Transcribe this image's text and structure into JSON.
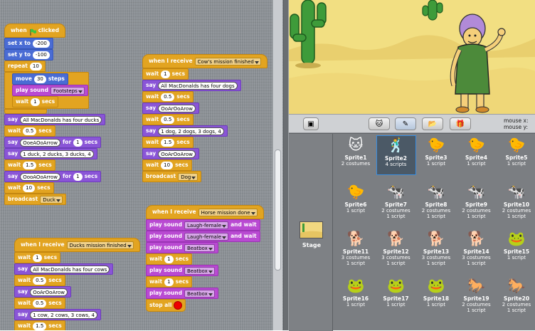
{
  "scripts": {
    "s1": {
      "hat_when": "when",
      "hat_clicked": "clicked",
      "set_x": "set x to",
      "set_x_val": "-200",
      "set_y": "set y to",
      "set_y_val": "-100",
      "repeat": "repeat",
      "repeat_val": "10",
      "move": "move",
      "move_val": "30",
      "move_steps": "steps",
      "play_sound": "play sound",
      "sound_val": "Footsteps",
      "wait1": "wait",
      "wait1_val": "1",
      "secs": "secs",
      "say1": "say",
      "say1_val": "All MacDonalds has four ducks",
      "wait2": "wait",
      "wait2_val": "0.5",
      "say2": "say",
      "say2_val": "OoeAOoArrow",
      "for": "for",
      "say2_secs": "1",
      "say3": "say",
      "say3_val": "1 duck, 2 ducks, 3 ducks, 4",
      "wait3": "wait",
      "wait3_val": "1.5",
      "say4": "say",
      "say4_val": "OooAOoArrow",
      "say4_secs": "1",
      "wait4": "wait",
      "wait4_val": "10",
      "broadcast": "broadcast",
      "broadcast_val": "Duck"
    },
    "s2": {
      "hat": "when I receive",
      "hat_val": "Cow's mission finished",
      "wait1_val": "1",
      "say1_val": "All MacDonalds has four dogs",
      "wait2_val": "0.5",
      "say2_val": "OoArOoArow",
      "wait3_val": "0.5",
      "say3_val": "1 dog, 2 dogs, 3 dogs, 4",
      "wait4_val": "1.5",
      "say4_val": "OoArOoArow",
      "wait5_val": "10",
      "broadcast_val": "Dog"
    },
    "s3": {
      "hat": "when I receive",
      "hat_val": "Horse mission done",
      "play1_val": "Laugh-female",
      "and_wait": "and wait",
      "play2_val": "Laugh-female",
      "play3_val": "Beatbox",
      "wait1_val": "1",
      "play4_val": "Beatbox",
      "wait2_val": "1",
      "play5_val": "Beatbox",
      "stop_all": "stop all"
    },
    "s4": {
      "hat": "when I receive",
      "hat_val": "Ducks mission finished",
      "wait1_val": "1",
      "say1_val": "All MacDonalds has four cows",
      "wait2_val": "0.5",
      "say2_val": "OoArOoArow",
      "wait3_val": "0.5",
      "say3_val": "1 cow, 2 cows, 3 cows, 4",
      "wait4_val": "1.5"
    }
  },
  "stage_bar": {
    "mouse_x": "mouse x:",
    "mouse_y": "mouse y:"
  },
  "sprite_list": {
    "stage_label": "Stage",
    "items": [
      {
        "name": "Sprite1",
        "info": "2 costumes",
        "icon": "cat-icon"
      },
      {
        "name": "Sprite2",
        "info": "4 scripts",
        "icon": "person-icon"
      },
      {
        "name": "Sprite3",
        "info": "1 script",
        "icon": "duck-icon"
      },
      {
        "name": "Sprite4",
        "info": "1 script",
        "icon": "duck-icon"
      },
      {
        "name": "Sprite5",
        "info": "1 script",
        "icon": "duck-icon"
      },
      {
        "name": "Sprite6",
        "info": "1 script",
        "icon": "duck-icon"
      },
      {
        "name": "Sprite7",
        "info": "2 costumes",
        "info2": "1 script",
        "icon": "cow-icon"
      },
      {
        "name": "Sprite8",
        "info": "2 costumes",
        "info2": "1 script",
        "icon": "cow-icon"
      },
      {
        "name": "Sprite9",
        "info": "2 costumes",
        "info2": "1 script",
        "icon": "cow-icon"
      },
      {
        "name": "Sprite10",
        "info": "2 costumes",
        "info2": "1 script",
        "icon": "cow-icon"
      },
      {
        "name": "Sprite11",
        "info": "3 costumes",
        "info2": "1 script",
        "icon": "dog-icon"
      },
      {
        "name": "Sprite12",
        "info": "3 costumes",
        "info2": "1 script",
        "icon": "dog-icon"
      },
      {
        "name": "Sprite13",
        "info": "3 costumes",
        "info2": "1 script",
        "icon": "dog-icon"
      },
      {
        "name": "Sprite14",
        "info": "3 costumes",
        "info2": "1 script",
        "icon": "dog-icon"
      },
      {
        "name": "Sprite15",
        "info": "1 script",
        "icon": "frog-icon"
      },
      {
        "name": "Sprite16",
        "info": "1 script",
        "icon": "frog-icon"
      },
      {
        "name": "Sprite17",
        "info": "1 script",
        "icon": "frog-icon"
      },
      {
        "name": "Sprite18",
        "info": "1 script",
        "icon": "frog-icon"
      },
      {
        "name": "Sprite19",
        "info": "2 costumes",
        "info2": "1 script",
        "icon": "horse-icon"
      },
      {
        "name": "Sprite20",
        "info": "2 costumes",
        "info2": "1 script",
        "icon": "horse-icon"
      }
    ]
  },
  "colors": {
    "control": "#e2a421",
    "motion": "#4a6cd4",
    "sound": "#b94ad2",
    "looks": "#8a55d7",
    "selected_border": "#3a8ee0"
  }
}
